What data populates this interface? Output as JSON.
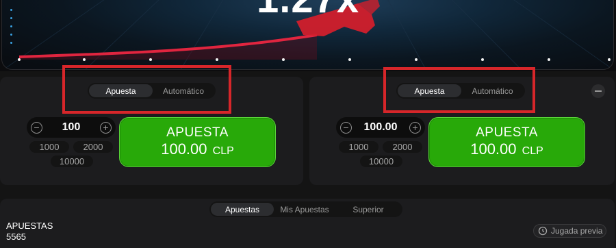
{
  "game": {
    "multiplier": "1.27x",
    "colors": {
      "curve": "#e0253f",
      "plane": "#d11f2c",
      "background": "#10273a"
    }
  },
  "panels": [
    {
      "tabs": [
        {
          "label": "Apuesta",
          "active": true
        },
        {
          "label": "Automático",
          "active": false
        }
      ],
      "stepper": {
        "value": "100",
        "minus_icon": "minus-icon",
        "plus_icon": "plus-icon"
      },
      "quick_amounts": [
        "1000",
        "2000",
        "10000"
      ],
      "bet_button": {
        "title": "APUESTA",
        "amount": "100.00",
        "currency": "CLP"
      }
    },
    {
      "tabs": [
        {
          "label": "Apuesta",
          "active": true
        },
        {
          "label": "Automático",
          "active": false
        }
      ],
      "stepper": {
        "value": "100.00",
        "minus_icon": "minus-icon",
        "plus_icon": "plus-icon"
      },
      "quick_amounts": [
        "1000",
        "2000",
        "10000"
      ],
      "bet_button": {
        "title": "APUESTA",
        "amount": "100.00",
        "currency": "CLP"
      }
    }
  ],
  "bets_list": {
    "tabs": [
      {
        "label": "Apuestas",
        "active": true
      },
      {
        "label": "Mis Apuestas",
        "active": false
      },
      {
        "label": "Superior",
        "active": false
      }
    ],
    "title": "APUESTAS",
    "count": "5565",
    "previous_round_label": "Jugada previa"
  },
  "colors": {
    "bet_green": "#28a909",
    "highlight_red": "#d6262a",
    "panel_bg": "#1c1c1e"
  }
}
